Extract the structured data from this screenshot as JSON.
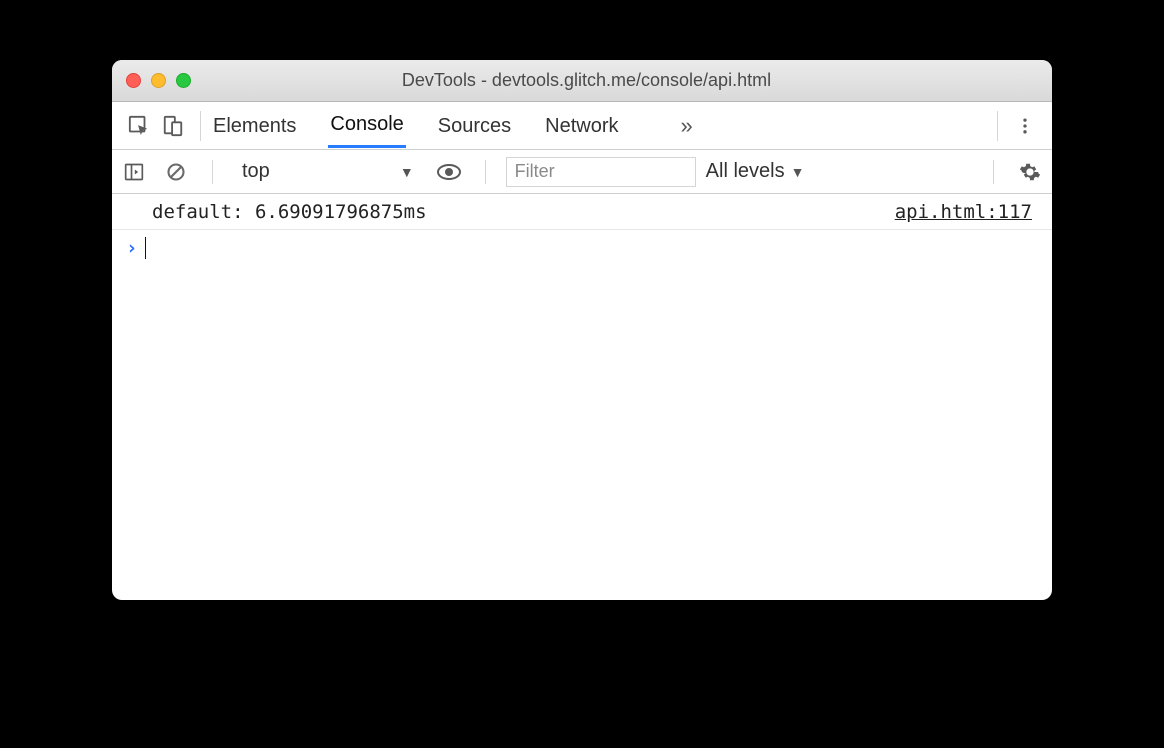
{
  "window": {
    "title": "DevTools - devtools.glitch.me/console/api.html"
  },
  "toolbar": {
    "tabs": [
      "Elements",
      "Console",
      "Sources",
      "Network"
    ],
    "active_tab_index": 1,
    "more_tabs_glyph": "»"
  },
  "filterbar": {
    "context": "top",
    "filter_placeholder": "Filter",
    "filter_value": "",
    "levels_label": "All levels"
  },
  "console": {
    "entries": [
      {
        "message": "default: 6.69091796875ms",
        "source": "api.html:117"
      }
    ],
    "prompt_glyph": "›"
  }
}
